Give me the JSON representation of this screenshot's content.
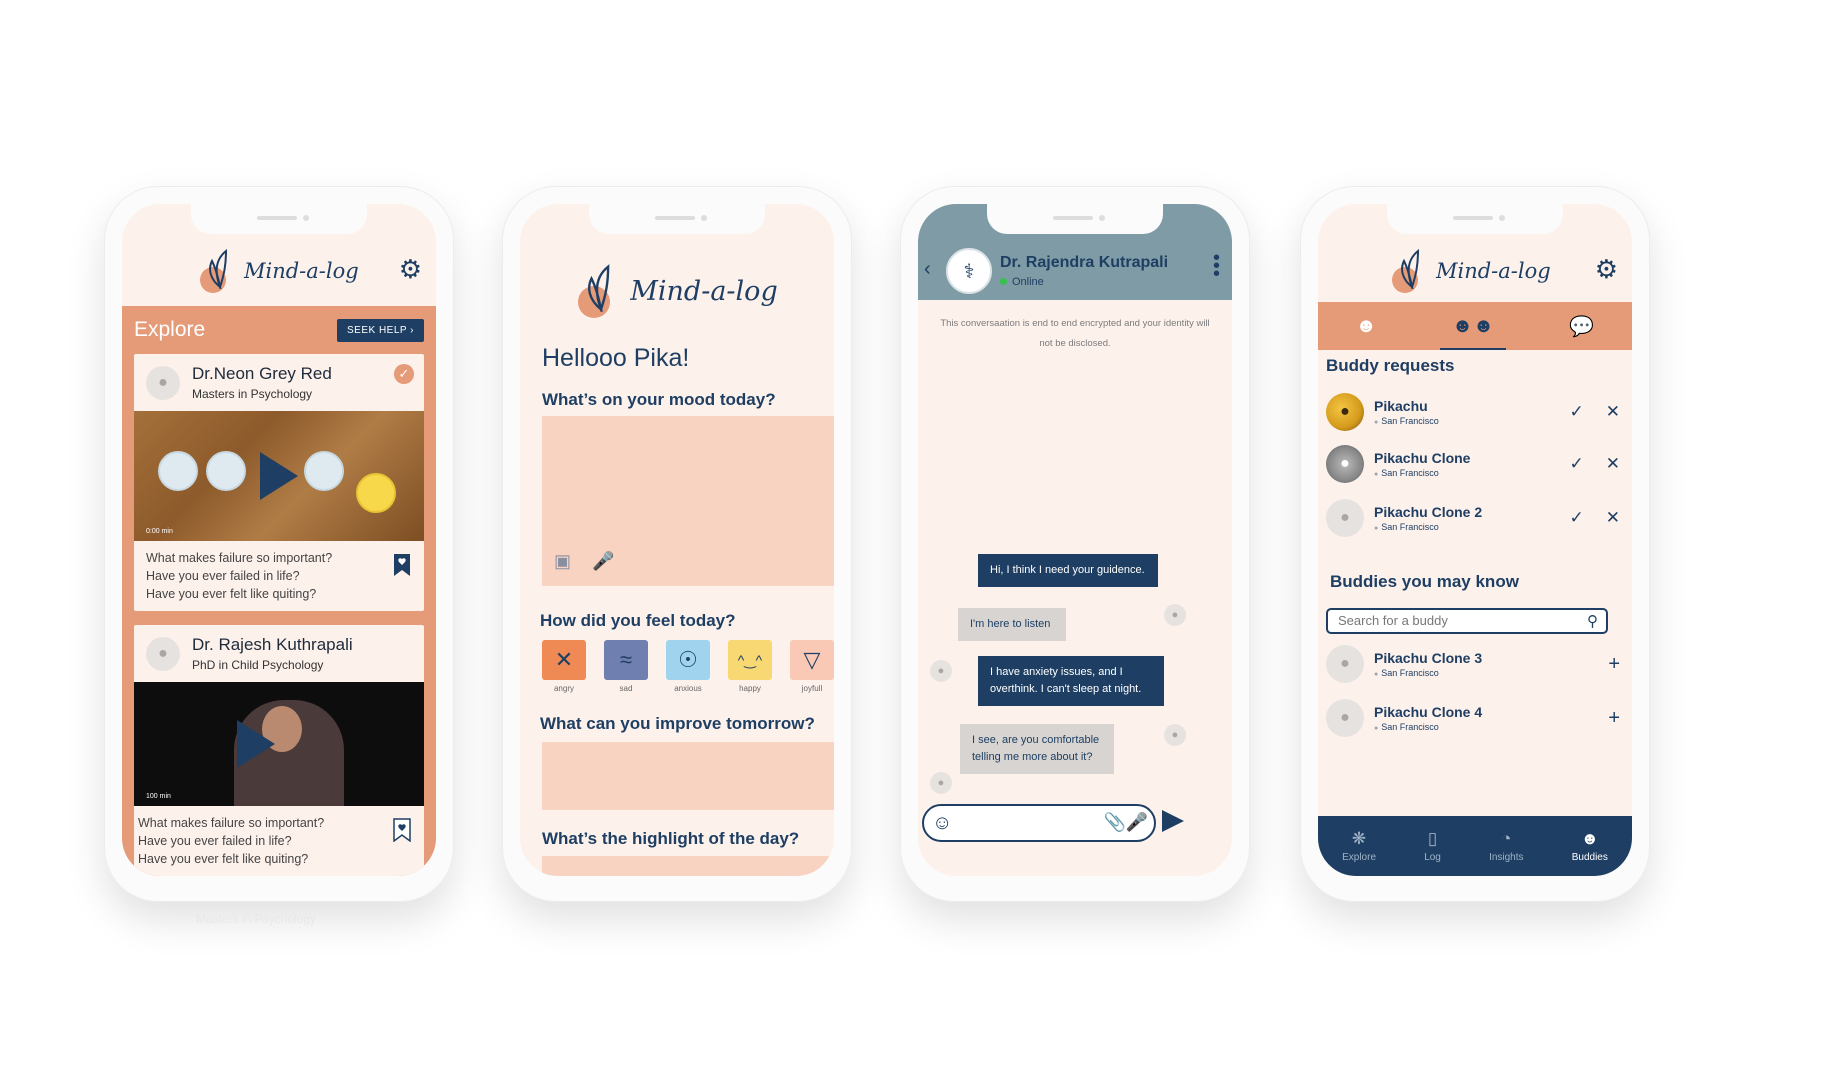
{
  "brand": {
    "name": "Mind-a-log"
  },
  "phone1": {
    "explore_title": "Explore",
    "seek_help": "SEEK HELP ›",
    "cards": [
      {
        "name": "Dr.Neon Grey Red",
        "subtitle": "Masters in Psychology",
        "duration": "0:00 min",
        "lines": [
          "What makes failure so important?",
          "Have you ever failed in life?",
          "Have you ever felt like quiting?"
        ]
      },
      {
        "name": "Dr. Rajesh Kuthrapali",
        "subtitle": "PhD in Child Psychology",
        "duration": "100 min",
        "lines": [
          "What makes failure so important?",
          "Have you ever failed in life?",
          "Have you ever felt like quiting?"
        ]
      }
    ],
    "reflection_text": "Masters in Psychology"
  },
  "phone2": {
    "greeting": "Hellooo Pika!",
    "q_mood": "What’s on your mood today?",
    "q_feel": "How did you feel today?",
    "moods": [
      {
        "label": "angry",
        "glyph": "✕",
        "color": "#f08a55"
      },
      {
        "label": "sad",
        "glyph": "≈",
        "color": "#6f7fb0"
      },
      {
        "label": "anxious",
        "glyph": "☉",
        "color": "#9fd3ee"
      },
      {
        "label": "happy",
        "glyph": "^‿^",
        "color": "#f7d873"
      },
      {
        "label": "joyfull",
        "glyph": "▽",
        "color": "#f9c9b6"
      }
    ],
    "q_improve": "What can you improve tomorrow?",
    "q_highlight": "What’s the highlight of the day?"
  },
  "phone3": {
    "doctor_name": "Dr. Rajendra Kutrapali",
    "status": "Online",
    "encryption_note": "This conversaation is end to end encrypted and your identity will not be disclosed.",
    "messages": [
      {
        "from": "me",
        "text": "Hi, I think I need your guidence."
      },
      {
        "from": "them",
        "text": "I'm here to listen"
      },
      {
        "from": "me",
        "text": "I have anxiety issues, and I overthink. I can't  sleep at night."
      },
      {
        "from": "them",
        "text": "I see, are you comfortable telling me more about it?"
      }
    ]
  },
  "phone4": {
    "requests_title": "Buddy requests",
    "requests": [
      {
        "name": "Pikachu",
        "location": "San Francisco"
      },
      {
        "name": "Pikachu Clone",
        "location": "San Francisco"
      },
      {
        "name": "Pikachu Clone 2",
        "location": "San Francisco"
      }
    ],
    "suggest_title": "Buddies you may know",
    "search_placeholder": "Search for a buddy",
    "suggestions": [
      {
        "name": "Pikachu Clone 3",
        "location": "San Francisco"
      },
      {
        "name": "Pikachu Clone 4",
        "location": "San Francisco"
      }
    ],
    "nav": [
      {
        "label": "Explore",
        "icon": "compass-icon"
      },
      {
        "label": "Log",
        "icon": "book-icon"
      },
      {
        "label": "Insights",
        "icon": "pie-chart-icon"
      },
      {
        "label": "Buddies",
        "icon": "people-icon",
        "active": true
      }
    ]
  },
  "colors": {
    "navy": "#1e3f63",
    "peach": "#e59a78",
    "cream": "#fdf1ec",
    "slate": "#7f9ba6"
  }
}
